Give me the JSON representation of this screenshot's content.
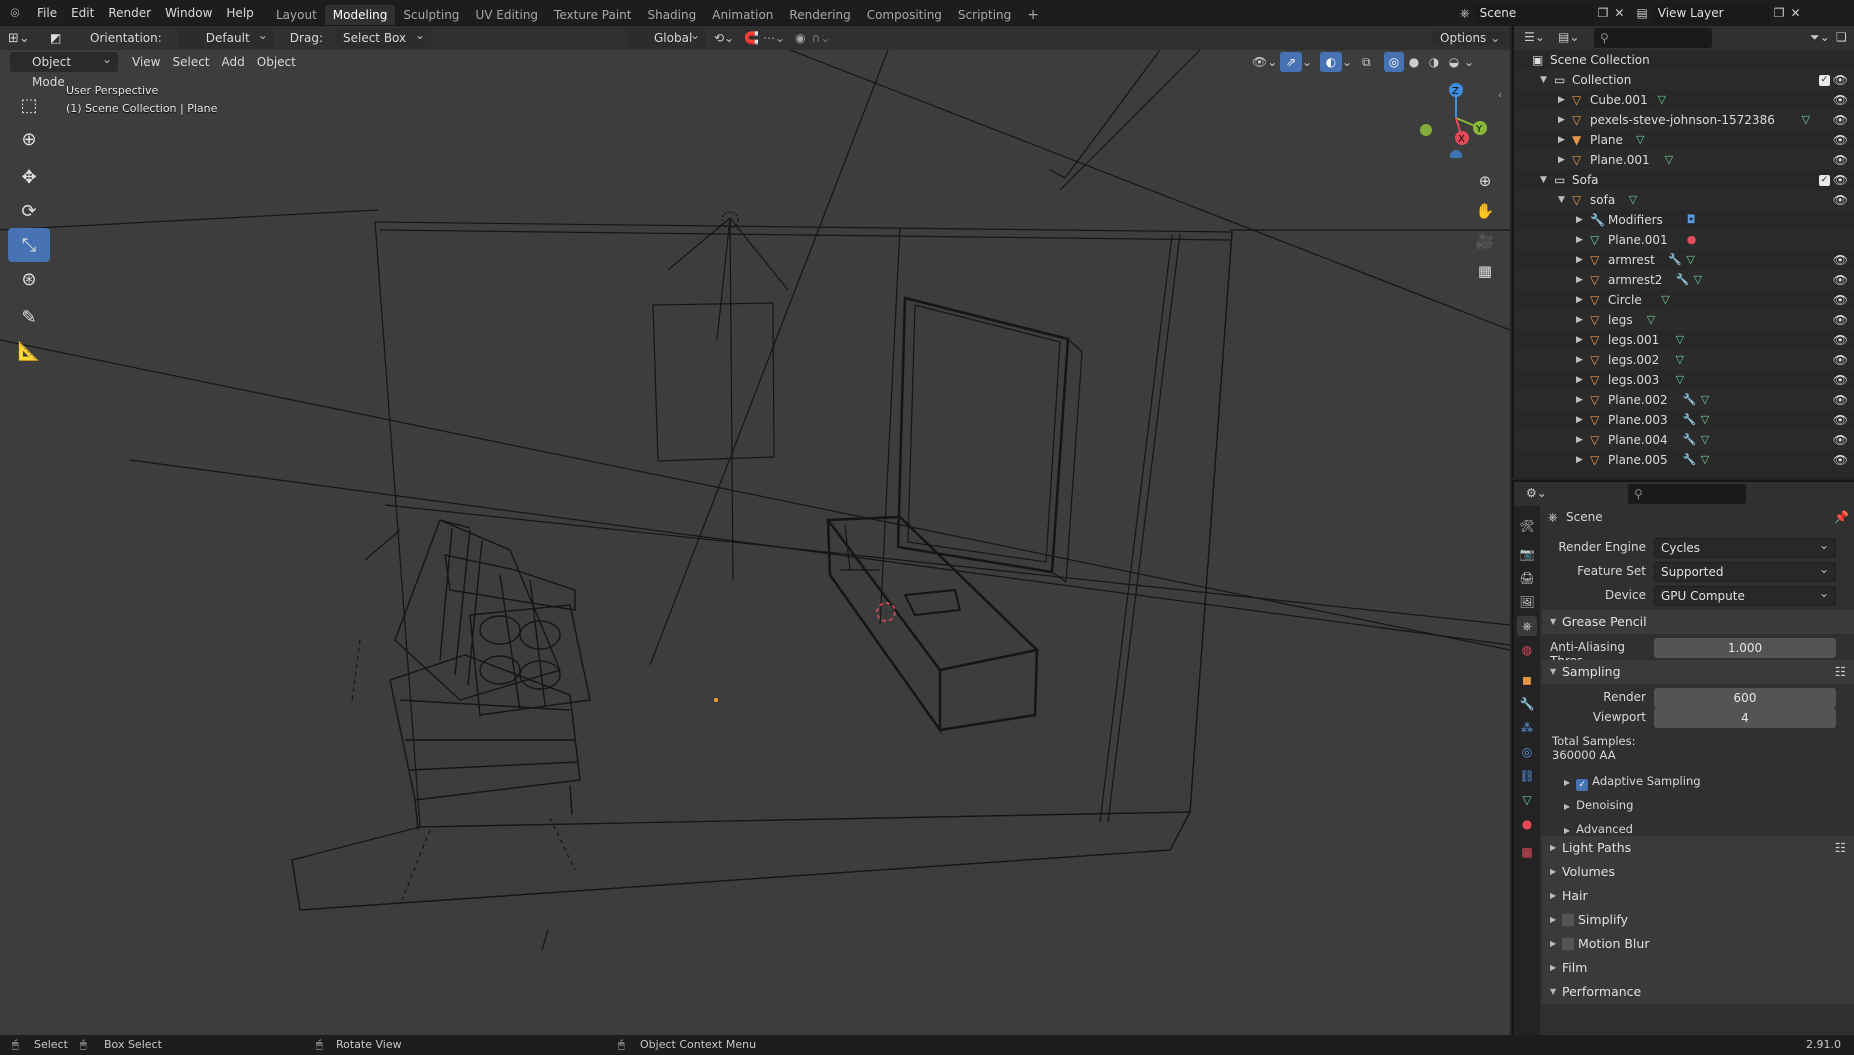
{
  "menu": [
    "File",
    "Edit",
    "Render",
    "Window",
    "Help"
  ],
  "workspaces": [
    "Layout",
    "Modeling",
    "Sculpting",
    "UV Editing",
    "Texture Paint",
    "Shading",
    "Animation",
    "Rendering",
    "Compositing",
    "Scripting"
  ],
  "active_workspace": "Modeling",
  "scene_name": "Scene",
  "view_layer": "View Layer",
  "tool_header": {
    "orientation_label": "Orientation:",
    "orientation_value": "Default",
    "drag_label": "Drag:",
    "drag_value": "Select Box",
    "transform_orientation": "Global",
    "options_label": "Options"
  },
  "mode_header": {
    "mode": "Object Mode",
    "view": "View",
    "select": "Select",
    "add": "Add",
    "object": "Object"
  },
  "viewport": {
    "perspective_label": "User Perspective",
    "context_label": "(1) Scene Collection | Plane",
    "gizmo_axes": [
      "Z",
      "Y",
      "X"
    ]
  },
  "outliner": {
    "root": "Scene Collection",
    "rows": [
      {
        "label": "Collection",
        "type": "collection",
        "level": 0,
        "expanded": true
      },
      {
        "label": "Cube.001",
        "type": "object",
        "level": 1,
        "expanded": false
      },
      {
        "label": "pexels-steve-johnson-1572386",
        "type": "object",
        "level": 1,
        "expanded": false
      },
      {
        "label": "Plane",
        "type": "object-active",
        "level": 1,
        "expanded": false
      },
      {
        "label": "Plane.001",
        "type": "object",
        "level": 1,
        "expanded": false
      },
      {
        "label": "Sofa",
        "type": "collection",
        "level": 0,
        "expanded": true
      },
      {
        "label": "sofa",
        "type": "object",
        "level": 1,
        "expanded": true
      },
      {
        "label": "Modifiers",
        "type": "modifiers",
        "level": 2,
        "expanded": false
      },
      {
        "label": "Plane.001",
        "type": "mesh",
        "level": 2,
        "expanded": false
      },
      {
        "label": "armrest",
        "type": "object",
        "level": 2,
        "expanded": false
      },
      {
        "label": "armrest2",
        "type": "object",
        "level": 2,
        "expanded": false
      },
      {
        "label": "Circle",
        "type": "object",
        "level": 2,
        "expanded": false
      },
      {
        "label": "legs",
        "type": "object",
        "level": 2,
        "expanded": false
      },
      {
        "label": "legs.001",
        "type": "object",
        "level": 2,
        "expanded": false
      },
      {
        "label": "legs.002",
        "type": "object",
        "level": 2,
        "expanded": false
      },
      {
        "label": "legs.003",
        "type": "object",
        "level": 2,
        "expanded": false
      },
      {
        "label": "Plane.002",
        "type": "object",
        "level": 2,
        "expanded": false
      },
      {
        "label": "Plane.003",
        "type": "object",
        "level": 2,
        "expanded": false
      },
      {
        "label": "Plane.004",
        "type": "object",
        "level": 2,
        "expanded": false
      },
      {
        "label": "Plane.005",
        "type": "object",
        "level": 2,
        "expanded": false
      }
    ]
  },
  "properties": {
    "context": "Scene",
    "render_engine_label": "Render Engine",
    "render_engine": "Cycles",
    "feature_set_label": "Feature Set",
    "feature_set": "Supported",
    "device_label": "Device",
    "device": "GPU Compute",
    "grease_pencil": "Grease Pencil",
    "anti_alias_label": "Anti-Aliasing Thres...",
    "anti_alias_value": "1.000",
    "sampling": "Sampling",
    "render_label": "Render",
    "render_samples": "600",
    "viewport_label": "Viewport",
    "viewport_samples": "4",
    "total_samples_label": "Total Samples:",
    "total_samples_value": "360000 AA",
    "adaptive_sampling": "Adaptive Sampling",
    "denoising": "Denoising",
    "advanced": "Advanced",
    "light_paths": "Light Paths",
    "volumes": "Volumes",
    "hair": "Hair",
    "simplify": "Simplify",
    "motion_blur": "Motion Blur",
    "film": "Film",
    "performance": "Performance"
  },
  "statusbar": {
    "select": "Select",
    "box_select": "Box Select",
    "rotate_view": "Rotate View",
    "context_menu": "Object Context Menu",
    "version": "2.91.0"
  },
  "colors": {
    "accent": "#4772b3",
    "object_orange": "#e8974a",
    "mesh_green": "#6fd09a",
    "axis_x": "#e34b5b",
    "axis_y": "#8bb838",
    "axis_z": "#3d8fe3"
  }
}
